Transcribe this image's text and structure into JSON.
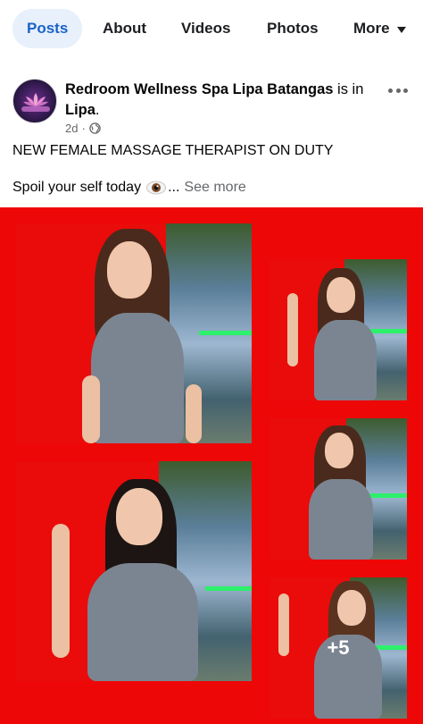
{
  "tabs": [
    {
      "label": "Posts",
      "active": true
    },
    {
      "label": "About"
    },
    {
      "label": "Videos"
    },
    {
      "label": "Photos"
    },
    {
      "label": "More"
    }
  ],
  "post": {
    "author": "Redroom Wellness Spa Lipa Batangas",
    "action_text": " is in ",
    "location": "Lipa",
    "location_suffix": ".",
    "time": "2d",
    "separator": "·",
    "privacy_icon": "globe-icon",
    "text_line1": "NEW FEMALE MASSAGE THERAPIST ON DUTY",
    "text_line2": "Spoil your self today",
    "text_line2_suffix": "...",
    "see_more": "See more"
  },
  "photos": {
    "count_overlay": "+5"
  },
  "colors": {
    "accent": "#1b63c6",
    "active_tab_bg": "#e7f0fb",
    "collage_bg": "#ee0707",
    "meta_gray": "#65676b"
  }
}
